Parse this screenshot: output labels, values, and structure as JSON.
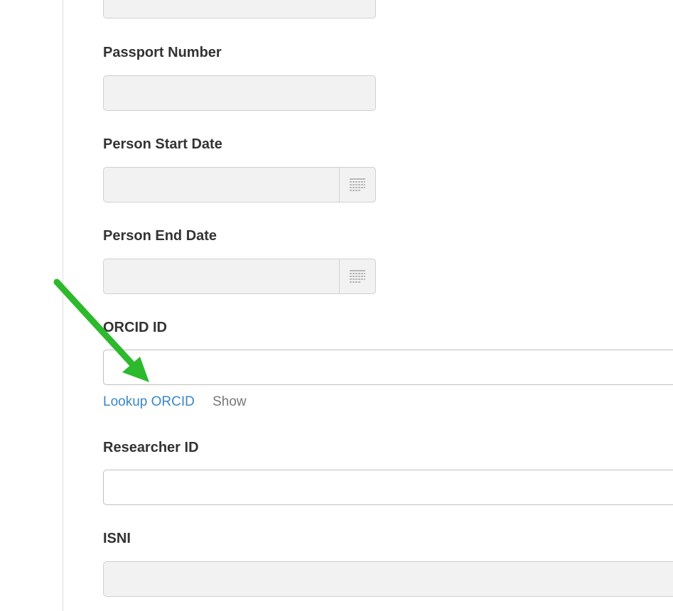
{
  "form": {
    "fields": {
      "passport_number": {
        "label": "Passport Number",
        "value": ""
      },
      "person_start_date": {
        "label": "Person Start Date",
        "value": ""
      },
      "person_end_date": {
        "label": "Person End Date",
        "value": ""
      },
      "orcid_id": {
        "label": "ORCID ID",
        "value": ""
      },
      "researcher_id": {
        "label": "Researcher ID",
        "value": ""
      },
      "isni": {
        "label": "ISNI",
        "value": ""
      }
    },
    "orcid_actions": {
      "lookup_label": "Lookup ORCID",
      "show_label": "Show"
    }
  },
  "icons": {
    "calendar": "calendar-icon",
    "annotation": "arrow-icon"
  },
  "colors": {
    "link": "#3a87c5",
    "secondary_link": "#777777",
    "label": "#333333",
    "disabled_field": "#f2f2f2",
    "annotation_arrow": "#2db92d"
  }
}
